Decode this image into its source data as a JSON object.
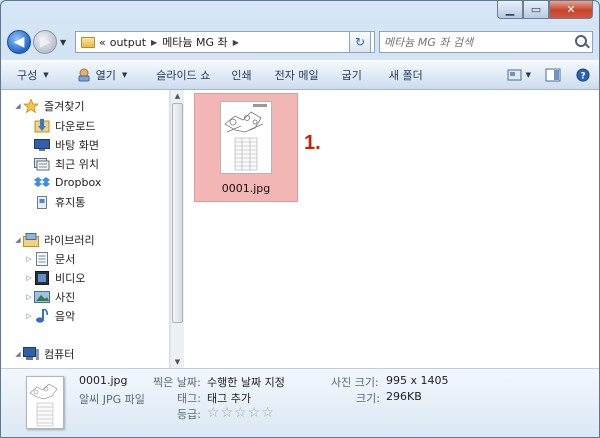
{
  "window": {
    "address": {
      "recent_arrow": "▼",
      "overflow": "«",
      "crumbs": [
        "output",
        "메타늄 MG 좌"
      ],
      "refresh_icon": "refresh-icon"
    },
    "search": {
      "placeholder": "메타늄 MG 좌 검색"
    }
  },
  "toolbar": {
    "organize": "구성",
    "open": "열기",
    "slideshow": "슬라이드 쇼",
    "print": "인쇄",
    "email": "전자 메일",
    "burn": "굽기",
    "new_folder": "새 폴더"
  },
  "nav": {
    "favorites": {
      "label": "즐겨찾기",
      "items": [
        "다운로드",
        "바탕 화면",
        "최근 위치",
        "Dropbox",
        "휴지통"
      ]
    },
    "libraries": {
      "label": "라이브러리",
      "items": [
        "문서",
        "비디오",
        "사진",
        "음악"
      ]
    },
    "computer": {
      "label": "컴퓨터"
    }
  },
  "content": {
    "files": [
      {
        "name": "0001.jpg"
      }
    ],
    "annotation": "1."
  },
  "details": {
    "name": "0001.jpg",
    "type": "알씨 JPG 파일",
    "date_label": "찍은 날짜:",
    "date_value": "수행한 날짜 지정",
    "tags_label": "태그:",
    "tags_value": "태그 추가",
    "rating_label": "등급:",
    "rating_value": 0,
    "dims_label": "사진 크기:",
    "dims_value": "995 x 1405",
    "size_label": "크기:",
    "size_value": "296KB"
  },
  "colors": {
    "selection": "#f2b6b5",
    "annotation": "#cc2200",
    "toolbar_text": "#1e395b"
  }
}
